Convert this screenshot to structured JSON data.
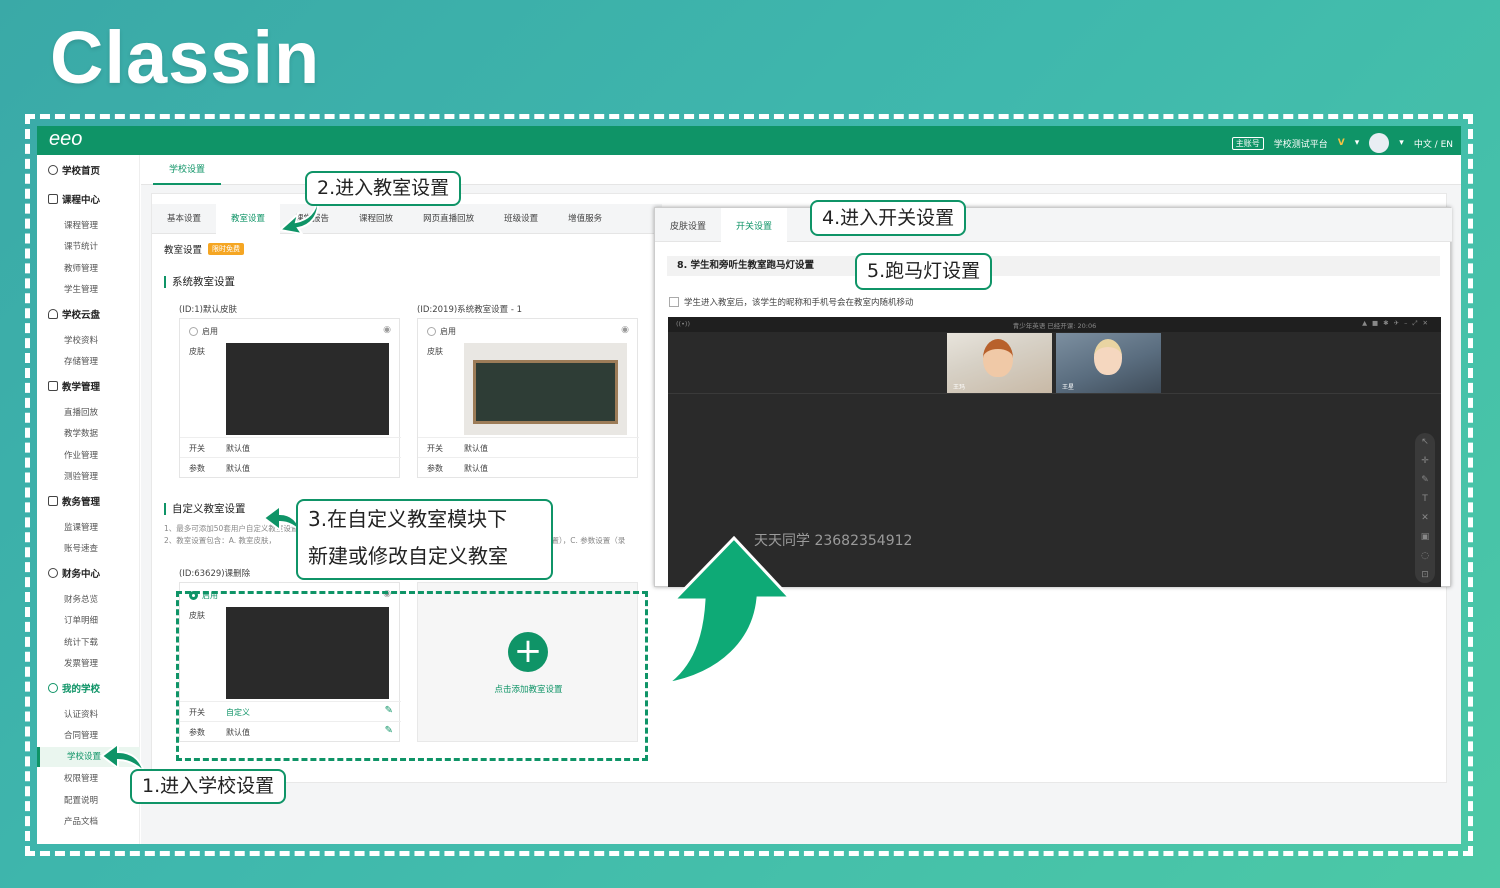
{
  "logo": "Classin",
  "topbar": {
    "brand": "eeo",
    "account_badge": "主账号",
    "school_name": "学校测试平台",
    "vip": "V",
    "lang": "中文 / EN"
  },
  "sidebar": {
    "sections": [
      {
        "label": "学校首页",
        "icon": "home-icon",
        "items": []
      },
      {
        "label": "课程中心",
        "icon": "calendar-icon",
        "items": [
          "课程管理",
          "课节统计",
          "教师管理",
          "学生管理"
        ]
      },
      {
        "label": "学校云盘",
        "icon": "cloud-icon",
        "items": [
          "学校资料",
          "存储管理"
        ]
      },
      {
        "label": "教学管理",
        "icon": "board-icon",
        "items": [
          "直播回放",
          "教学数据",
          "作业管理",
          "测验管理"
        ]
      },
      {
        "label": "教务管理",
        "icon": "grid-icon",
        "items": [
          "监课管理",
          "账号速查"
        ]
      },
      {
        "label": "财务中心",
        "icon": "money-icon",
        "items": [
          "财务总览",
          "订单明细",
          "统计下载",
          "发票管理"
        ]
      },
      {
        "label": "我的学校",
        "icon": "school-icon",
        "items": [
          "认证资料",
          "合同管理",
          "学校设置",
          "权限管理",
          "配置说明",
          "产品文档"
        ]
      }
    ],
    "active_item": "学校设置"
  },
  "main": {
    "page_tab": "学校设置",
    "subtabs": [
      "基本设置",
      "教室设置",
      "课堂报告",
      "课程回放",
      "网页直播回放",
      "班级设置",
      "增值服务"
    ],
    "active_subtab": "教室设置",
    "room_title": "教室设置",
    "free_badge": "限时免费",
    "system_title": "系统教室设置",
    "skins": [
      {
        "name": "(ID:1)默认皮肤",
        "enable": "启用",
        "skin_label": "皮肤",
        "switch_label": "开关",
        "switch_value": "默认值",
        "param_label": "参数",
        "param_value": "默认值"
      },
      {
        "name": "(ID:2019)系统教室设置 - 1",
        "enable": "启用",
        "skin_label": "皮肤",
        "switch_label": "开关",
        "switch_value": "默认值",
        "param_label": "参数",
        "param_value": "默认值"
      }
    ],
    "custom_title": "自定义教室设置",
    "notes": [
      "1、最多可添加50套用户自定义教室设置",
      "2、教室设置包含：A. 教室皮肤，",
      "设置），C. 参数设置（录"
    ],
    "custom_skin": {
      "name": "(ID:63629)课删除",
      "enable": "启用",
      "skin_label": "皮肤",
      "switch_label": "开关",
      "switch_value": "自定义",
      "param_label": "参数",
      "param_value": "默认值"
    },
    "add_label": "点击添加教室设置"
  },
  "panel": {
    "tabs": [
      "皮肤设置",
      "开关设置"
    ],
    "active_tab": "开关设置",
    "section_title": "8. 学生和旁听生教室跑马灯设置",
    "checkbox_label": "学生进入教室后，该学生的昵称和手机号会在教室内随机移动",
    "video_title": "青少年英语  已经开课: 20:06",
    "tiles": [
      {
        "name": "王玛"
      },
      {
        "name": "王星"
      }
    ],
    "marquee_text": "天天同学 23682354912"
  },
  "callouts": {
    "step1": "1.进入学校设置",
    "step2": "2.进入教室设置",
    "step3_line1": "3.在自定义教室模块下",
    "step3_line2": "新建或修改自定义教室",
    "step4": "4.进入开关设置",
    "step5": "5.跑马灯设置"
  },
  "colors": {
    "brand": "#0f9467",
    "accent": "#f5a623",
    "background": "#3fb8ad"
  }
}
